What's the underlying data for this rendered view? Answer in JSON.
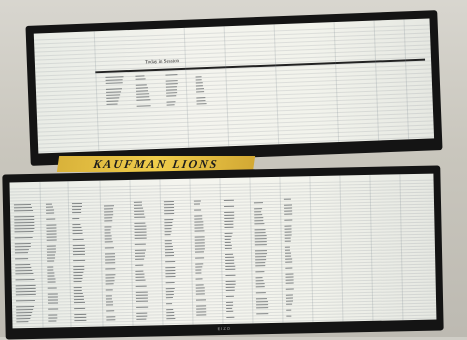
{
  "scene": {
    "description_tag": "photo of two wide monitors showing spreadsheets",
    "sign_text": "KAUFMAN LIONS",
    "top_sheet_title": "Today in Session",
    "bottom_brand": "EIZO",
    "colors": {
      "wall": "#cfcdc6",
      "bezel": "#141414",
      "screen": "#f2f3ec",
      "sign": "#f0cd4b"
    }
  }
}
